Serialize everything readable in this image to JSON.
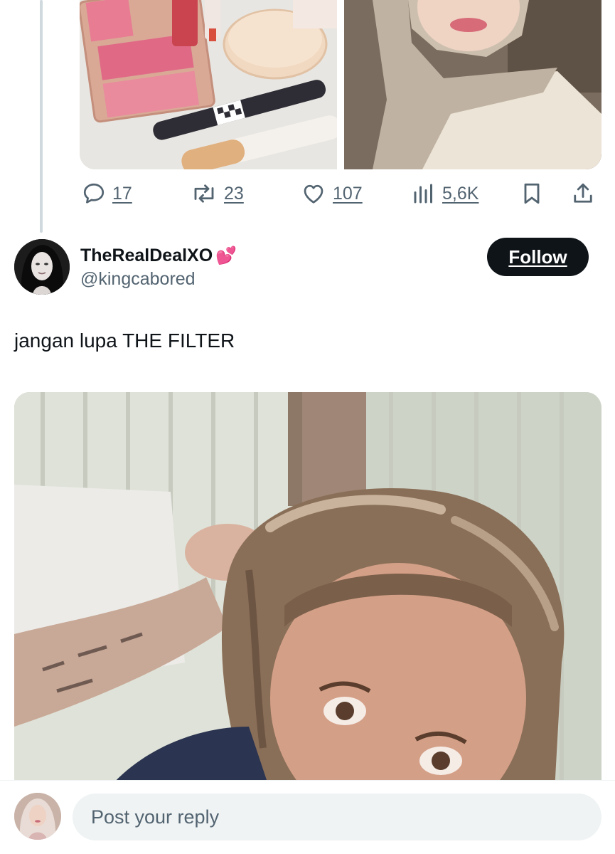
{
  "previous_tweet": {
    "actions": {
      "replies": "17",
      "reposts": "23",
      "likes": "107",
      "views": "5,6K"
    }
  },
  "tweet": {
    "display_name": "TheRealDealXO",
    "name_emoji": "💕",
    "handle": "@kingcabored",
    "follow_label": "Follow",
    "text": "jangan lupa THE FILTER"
  },
  "reply_bar": {
    "placeholder": "Post your reply"
  },
  "colors": {
    "text_primary": "#0f1419",
    "text_secondary": "#536471",
    "follow_bg": "#0f1419",
    "input_bg": "#eff3f4"
  }
}
